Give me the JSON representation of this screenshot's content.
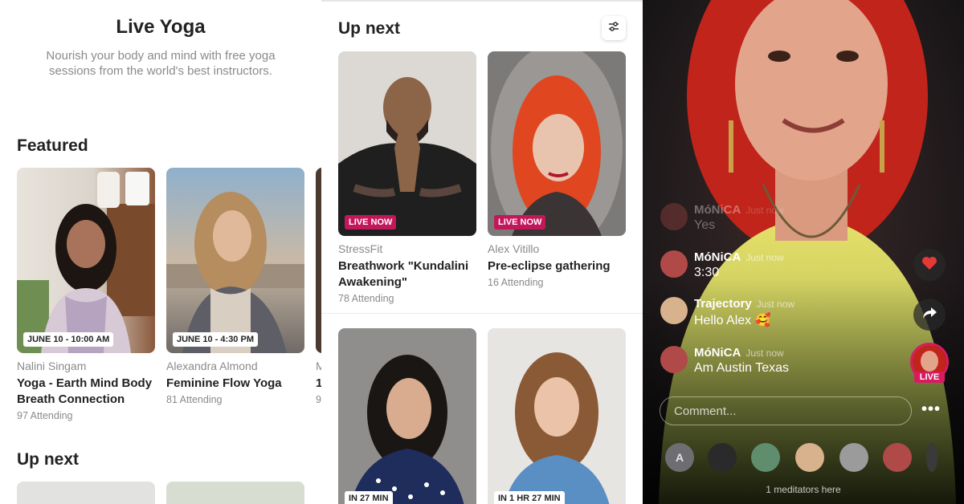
{
  "panel1": {
    "title": "Live Yoga",
    "subtitle": "Nourish your body and mind with free yoga sessions from the world's best instructors.",
    "featured_title": "Featured",
    "upnext_title": "Up next",
    "featured": [
      {
        "date": "JUNE 10 - 10:00 AM",
        "host": "Nalini Singam",
        "title": "Yoga - Earth Mind Body Breath Connection",
        "attending": "97 Attending"
      },
      {
        "date": "JUNE 10 - 4:30 PM",
        "host": "Alexandra Almond",
        "title": "Feminine Flow Yoga",
        "attending": "81 Attending"
      },
      {
        "host": "M",
        "title": "1",
        "attending": "9"
      }
    ]
  },
  "panel2": {
    "title": "Up next",
    "filter_icon": "sliders-icon",
    "cards": [
      {
        "badge": "LIVE NOW",
        "host": "StressFit",
        "title": "Breathwork \"Kundalini Awakening\"",
        "attending": "78 Attending"
      },
      {
        "badge": "LIVE NOW",
        "host": "Alex Vitillo",
        "title": "Pre-eclipse gathering",
        "attending": "16 Attending"
      },
      {
        "badge": "IN 27 MIN"
      },
      {
        "badge": "IN 1 HR 27 MIN"
      }
    ]
  },
  "panel3": {
    "messages": [
      {
        "name": "MóNiCA",
        "time": "Just now",
        "text": "Yes"
      },
      {
        "name": "MóNiCA",
        "time": "Just now",
        "text": "3:30"
      },
      {
        "name": "Trajectory",
        "time": "Just now",
        "text": "Hello Alex 🥰"
      },
      {
        "name": "MóNiCA",
        "time": "Just now",
        "text": "Am Austin Texas"
      }
    ],
    "heart_icon": "heart-icon",
    "share_icon": "share-icon",
    "live_label": "LIVE",
    "comment_placeholder": "Comment...",
    "more_label": "•••",
    "avatar_initial": "A",
    "meditators_count": "1 meditators here"
  },
  "colors": {
    "live_pink": "#c2185b",
    "text_dark": "#222222",
    "text_muted": "#8a8a8a"
  }
}
